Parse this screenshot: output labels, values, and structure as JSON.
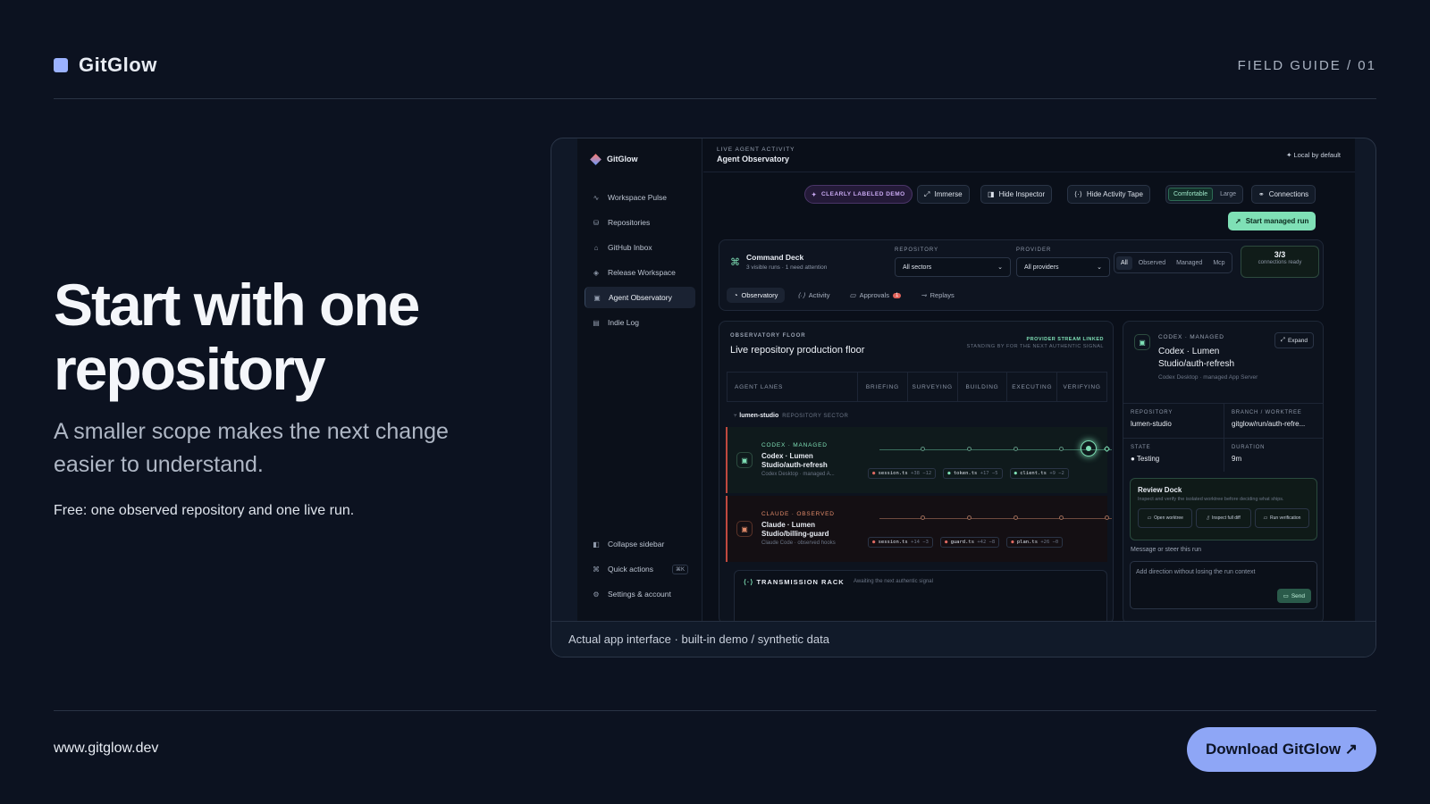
{
  "header": {
    "brand": "GitGlow",
    "guide": "FIELD GUIDE / 01"
  },
  "hero": {
    "title": "Start with one repository",
    "subtitle": "A smaller scope makes the next change easier to understand.",
    "note": "Free: one observed repository and one live run."
  },
  "footer": {
    "url": "www.gitglow.dev",
    "download": "Download GitGlow ↗"
  },
  "screenshot": {
    "caption": "Actual app interface · built-in demo / synthetic data"
  },
  "app": {
    "brand": "GitGlow",
    "sidebar": {
      "items": [
        {
          "label": "Workspace Pulse",
          "icon": "pulse-icon"
        },
        {
          "label": "Repositories",
          "icon": "repo-icon"
        },
        {
          "label": "GitHub Inbox",
          "icon": "inbox-icon"
        },
        {
          "label": "Release Workspace",
          "icon": "package-icon"
        },
        {
          "label": "Agent Observatory",
          "icon": "robot-icon",
          "active": true
        },
        {
          "label": "Indie Log",
          "icon": "book-icon"
        }
      ],
      "bottom": [
        {
          "label": "Collapse sidebar",
          "icon": "collapse-icon"
        },
        {
          "label": "Quick actions",
          "icon": "command-icon",
          "shortcut": "⌘K"
        },
        {
          "label": "Settings & account",
          "icon": "gear-icon"
        }
      ]
    },
    "topbar": {
      "eyebrow": "LIVE AGENT ACTIVITY",
      "title": "Agent Observatory",
      "local": "Local by default"
    },
    "toolbar": {
      "demo": "CLEARLY LABELED DEMO",
      "immerse": "Immerse",
      "hide_inspector": "Hide Inspector",
      "hide_tape": "Hide Activity Tape",
      "density": [
        "Comfortable",
        "Large"
      ],
      "connections": "Connections",
      "start": "Start managed run"
    },
    "deck": {
      "title": "Command Deck",
      "subtitle": "3 visible runs · 1 need attention",
      "repo_label": "REPOSITORY",
      "repo_value": "All sectors",
      "provider_label": "PROVIDER",
      "provider_value": "All providers",
      "filters": [
        "All",
        "Observed",
        "Managed",
        "Mcp"
      ],
      "conn_count": "3/3",
      "conn_text": "connections ready",
      "tabs": [
        {
          "label": "Observatory"
        },
        {
          "label": "Activity"
        },
        {
          "label": "Approvals",
          "badge": "1"
        },
        {
          "label": "Replays"
        }
      ]
    },
    "floor": {
      "eyebrow": "OBSERVATORY FLOOR",
      "title": "Live repository production floor",
      "linked": "PROVIDER STREAM LINKED",
      "linked_sub": "STANDING BY FOR THE NEXT AUTHENTIC SIGNAL",
      "lanes_label": "AGENT LANES",
      "stages": [
        "BRIEFING",
        "SURVEYING",
        "BUILDING",
        "EXECUTING",
        "VERIFYING"
      ],
      "sector": "lumen-studio",
      "sector_tag": "REPOSITORY SECTOR",
      "runs": [
        {
          "tag": "CODEX · MANAGED",
          "name": "Codex · Lumen Studio/auth-refresh",
          "meta": "Codex Desktop · managed A...",
          "chips": [
            {
              "file": "session.ts",
              "add": "+38",
              "del": "−12"
            },
            {
              "file": "token.ts",
              "add": "+17",
              "del": "−5"
            },
            {
              "file": "client.ts",
              "add": "+9",
              "del": "−2"
            }
          ]
        },
        {
          "tag": "CLAUDE · OBSERVED",
          "name": "Claude · Lumen Studio/billing-guard",
          "meta": "Claude Code · observed hooks",
          "chips": [
            {
              "file": "session.ts",
              "add": "+14",
              "del": "−3"
            },
            {
              "file": "guard.ts",
              "add": "+42",
              "del": "−8"
            },
            {
              "file": "plan.ts",
              "add": "+26",
              "del": "−0"
            }
          ]
        }
      ],
      "rack_title": "TRANSMISSION RACK",
      "rack_sub": "Awaiting the next authentic signal"
    },
    "inspector": {
      "tag": "CODEX · MANAGED",
      "name": "Codex · Lumen Studio/auth-refresh",
      "meta": "Codex Desktop · managed App Server",
      "expand": "Expand",
      "fields": [
        {
          "k": "REPOSITORY",
          "v": "lumen-studio"
        },
        {
          "k": "BRANCH / WORKTREE",
          "v": "gitglow/run/auth-refre..."
        },
        {
          "k": "STATE",
          "v": "● Testing"
        },
        {
          "k": "DURATION",
          "v": "9m"
        }
      ],
      "dock_title": "Review Dock",
      "dock_sub": "Inspect and verify the isolated worktree before deciding what ships.",
      "dock_buttons": [
        "Open worktree",
        "Inspect full diff",
        "Run verification"
      ],
      "message_label": "Message or steer this run",
      "message_placeholder": "Add direction without losing the run context",
      "send": "Send"
    },
    "colors": {
      "accent": "#7fe0b6",
      "brand": "#9bb2ff",
      "claude": "#e28b6a",
      "alert": "#e0625a"
    }
  }
}
